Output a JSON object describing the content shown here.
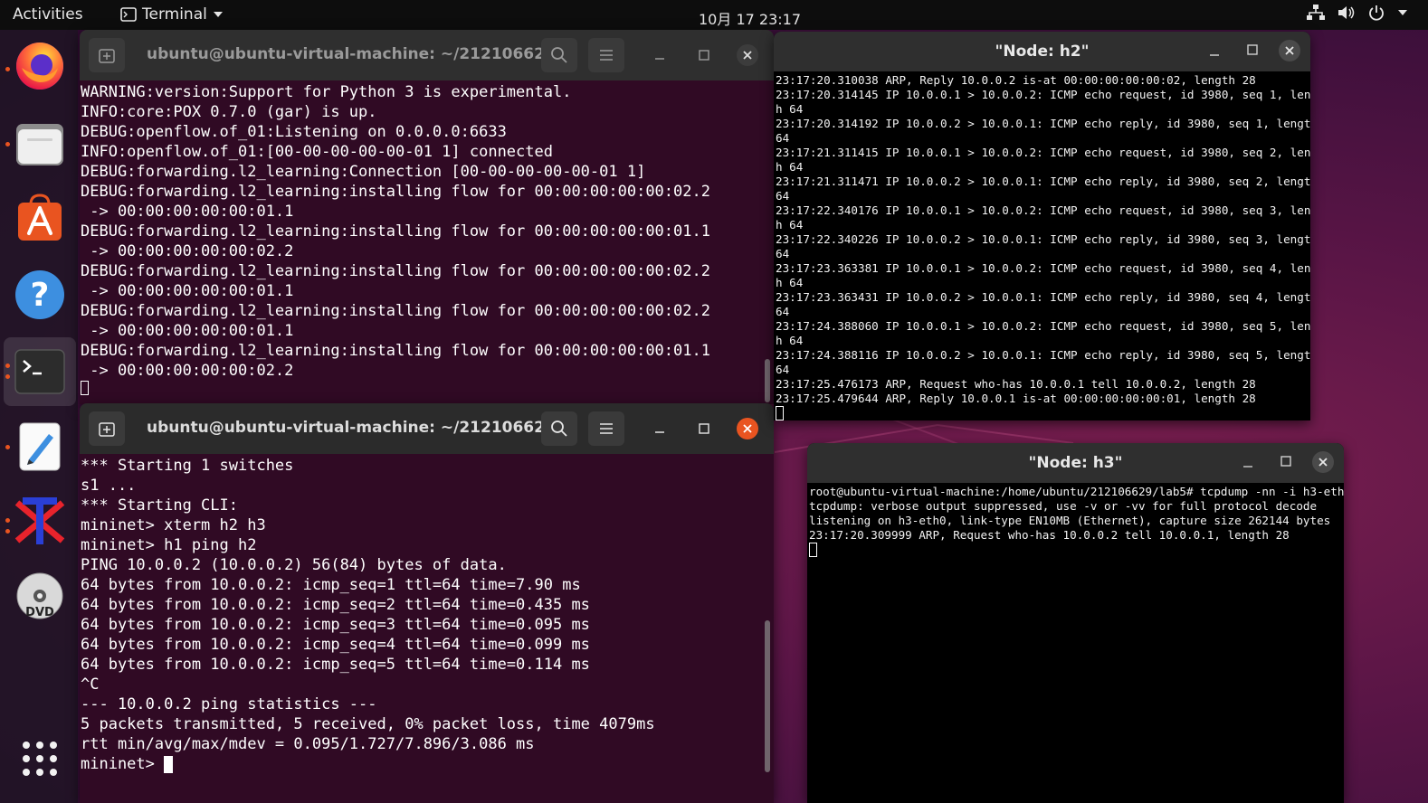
{
  "topbar": {
    "activities": "Activities",
    "app_name": "Terminal",
    "clock": "10月 17  23:17"
  },
  "dock": {
    "items": [
      "firefox-icon",
      "files-icon",
      "software-icon",
      "help-icon",
      "terminal-icon",
      "text-editor-icon",
      "xterm-icon",
      "dvd-icon",
      "show-apps-icon"
    ]
  },
  "window_top": {
    "title": "ubuntu@ubuntu-virtual-machine: ~/21210662...",
    "lines": [
      "WARNING:version:Support for Python 3 is experimental.",
      "INFO:core:POX 0.7.0 (gar) is up.",
      "DEBUG:openflow.of_01:Listening on 0.0.0.0:6633",
      "INFO:openflow.of_01:[00-00-00-00-00-01 1] connected",
      "DEBUG:forwarding.l2_learning:Connection [00-00-00-00-00-01 1]",
      "DEBUG:forwarding.l2_learning:installing flow for 00:00:00:00:00:02.2",
      " -> 00:00:00:00:00:01.1",
      "DEBUG:forwarding.l2_learning:installing flow for 00:00:00:00:00:01.1",
      " -> 00:00:00:00:00:02.2",
      "DEBUG:forwarding.l2_learning:installing flow for 00:00:00:00:00:02.2",
      " -> 00:00:00:00:00:01.1",
      "DEBUG:forwarding.l2_learning:installing flow for 00:00:00:00:00:02.2",
      " -> 00:00:00:00:00:01.1",
      "DEBUG:forwarding.l2_learning:installing flow for 00:00:00:00:00:01.1",
      " -> 00:00:00:00:00:02.2"
    ]
  },
  "window_bottom": {
    "title": "ubuntu@ubuntu-virtual-machine: ~/21210662...",
    "lines": [
      "*** Starting 1 switches",
      "s1 ...",
      "*** Starting CLI:",
      "mininet> xterm h2 h3",
      "mininet> h1 ping h2",
      "PING 10.0.0.2 (10.0.0.2) 56(84) bytes of data.",
      "64 bytes from 10.0.0.2: icmp_seq=1 ttl=64 time=7.90 ms",
      "64 bytes from 10.0.0.2: icmp_seq=2 ttl=64 time=0.435 ms",
      "64 bytes from 10.0.0.2: icmp_seq=3 ttl=64 time=0.095 ms",
      "64 bytes from 10.0.0.2: icmp_seq=4 ttl=64 time=0.099 ms",
      "64 bytes from 10.0.0.2: icmp_seq=5 ttl=64 time=0.114 ms",
      "^C",
      "--- 10.0.0.2 ping statistics ---",
      "5 packets transmitted, 5 received, 0% packet loss, time 4079ms",
      "rtt min/avg/max/mdev = 0.095/1.727/7.896/3.086 ms"
    ],
    "prompt": "mininet> "
  },
  "window_h2": {
    "title": "\"Node: h2\"",
    "lines": [
      "23:17:20.310038 ARP, Reply 10.0.0.2 is-at 00:00:00:00:00:02, length 28",
      "23:17:20.314145 IP 10.0.0.1 > 10.0.0.2: ICMP echo request, id 3980, seq 1, lengt",
      "h 64",
      "23:17:20.314192 IP 10.0.0.2 > 10.0.0.1: ICMP echo reply, id 3980, seq 1, length",
      "64",
      "23:17:21.311415 IP 10.0.0.1 > 10.0.0.2: ICMP echo request, id 3980, seq 2, lengt",
      "h 64",
      "23:17:21.311471 IP 10.0.0.2 > 10.0.0.1: ICMP echo reply, id 3980, seq 2, length",
      "64",
      "23:17:22.340176 IP 10.0.0.1 > 10.0.0.2: ICMP echo request, id 3980, seq 3, lengt",
      "h 64",
      "23:17:22.340226 IP 10.0.0.2 > 10.0.0.1: ICMP echo reply, id 3980, seq 3, length",
      "64",
      "23:17:23.363381 IP 10.0.0.1 > 10.0.0.2: ICMP echo request, id 3980, seq 4, lengt",
      "h 64",
      "23:17:23.363431 IP 10.0.0.2 > 10.0.0.1: ICMP echo reply, id 3980, seq 4, length",
      "64",
      "23:17:24.388060 IP 10.0.0.1 > 10.0.0.2: ICMP echo request, id 3980, seq 5, lengt",
      "h 64",
      "23:17:24.388116 IP 10.0.0.2 > 10.0.0.1: ICMP echo reply, id 3980, seq 5, length",
      "64",
      "23:17:25.476173 ARP, Request who-has 10.0.0.1 tell 10.0.0.2, length 28",
      "23:17:25.479644 ARP, Reply 10.0.0.1 is-at 00:00:00:00:00:01, length 28"
    ]
  },
  "window_h3": {
    "title": "\"Node: h3\"",
    "lines": [
      "root@ubuntu-virtual-machine:/home/ubuntu/212106629/lab5# tcpdump -nn -i h3-eth0",
      "tcpdump: verbose output suppressed, use -v or -vv for full protocol decode",
      "listening on h3-eth0, link-type EN10MB (Ethernet), capture size 262144 bytes",
      "23:17:20.309999 ARP, Request who-has 10.0.0.2 tell 10.0.0.1, length 28"
    ]
  },
  "colors": {
    "terminal_bg": "#300a24",
    "accent_orange": "#e95420",
    "xterm_bg": "#000000"
  }
}
